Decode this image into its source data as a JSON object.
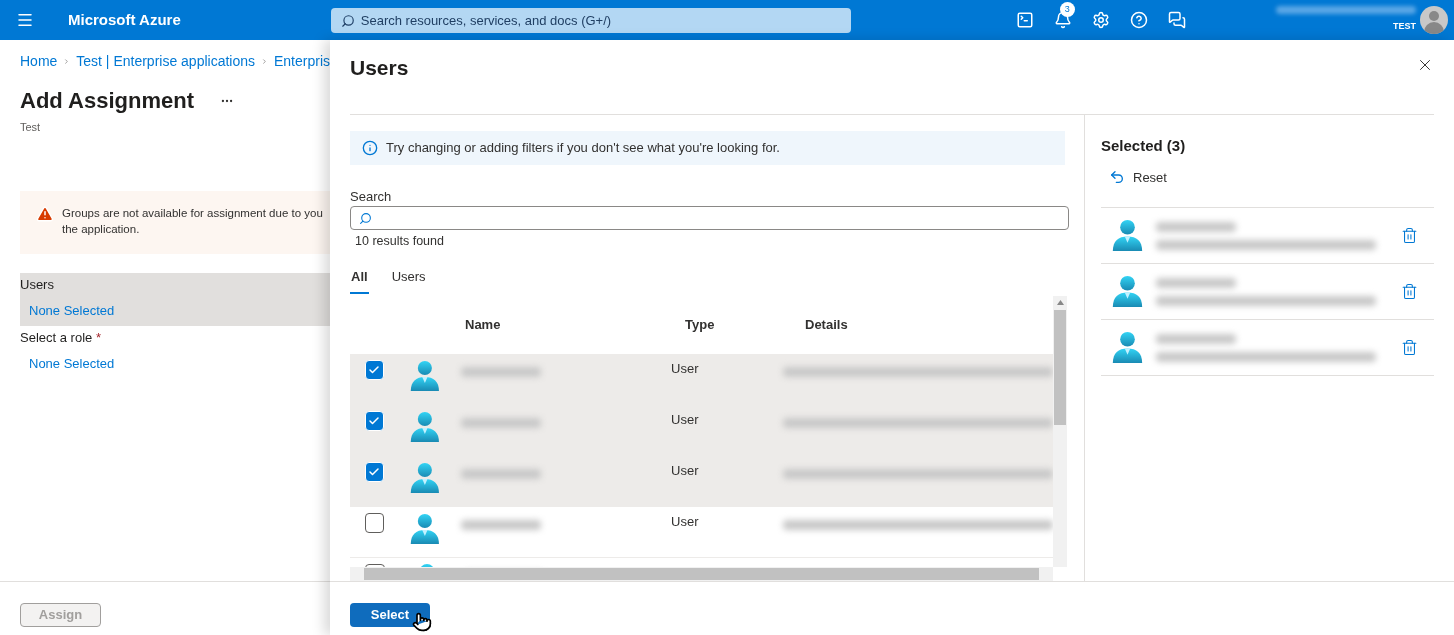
{
  "header": {
    "app_name": "Microsoft Azure",
    "search": {
      "placeholder": "Search resources, services, and docs (G+/)"
    },
    "notification_count": "3",
    "account_label": "TEST"
  },
  "breadcrumb": [
    "Home",
    "Test | Enterprise applications",
    "Enterpris"
  ],
  "page": {
    "title": "Add Assignment",
    "subtitle": "Test"
  },
  "warning": {
    "lines": [
      "Groups are not available for assignment due to you",
      "the application."
    ]
  },
  "fields": [
    {
      "label": "Users",
      "value": "None Selected",
      "highlighted": true
    },
    {
      "label": "Select a role",
      "required_mark": "*",
      "value": "None Selected",
      "highlighted": false
    }
  ],
  "assign_button": {
    "label": "Assign",
    "disabled": true
  },
  "panel": {
    "title": "Users",
    "info": "Try changing or adding filters if you don't see what you're looking for.",
    "search_label": "Search",
    "results_count": "10 results found",
    "tabs": [
      {
        "label": "All",
        "selected": true
      },
      {
        "label": "Users",
        "selected": false
      }
    ],
    "table": {
      "columns": [
        "Name",
        "Type",
        "Details"
      ],
      "rows": [
        {
          "selected": true,
          "type": "User"
        },
        {
          "selected": true,
          "type": "User"
        },
        {
          "selected": true,
          "type": "User"
        },
        {
          "selected": false,
          "type": "User"
        },
        {
          "selected": false
        }
      ]
    },
    "selected_heading": "Selected (3)",
    "reset_label": "Reset",
    "select_button": "Select"
  }
}
